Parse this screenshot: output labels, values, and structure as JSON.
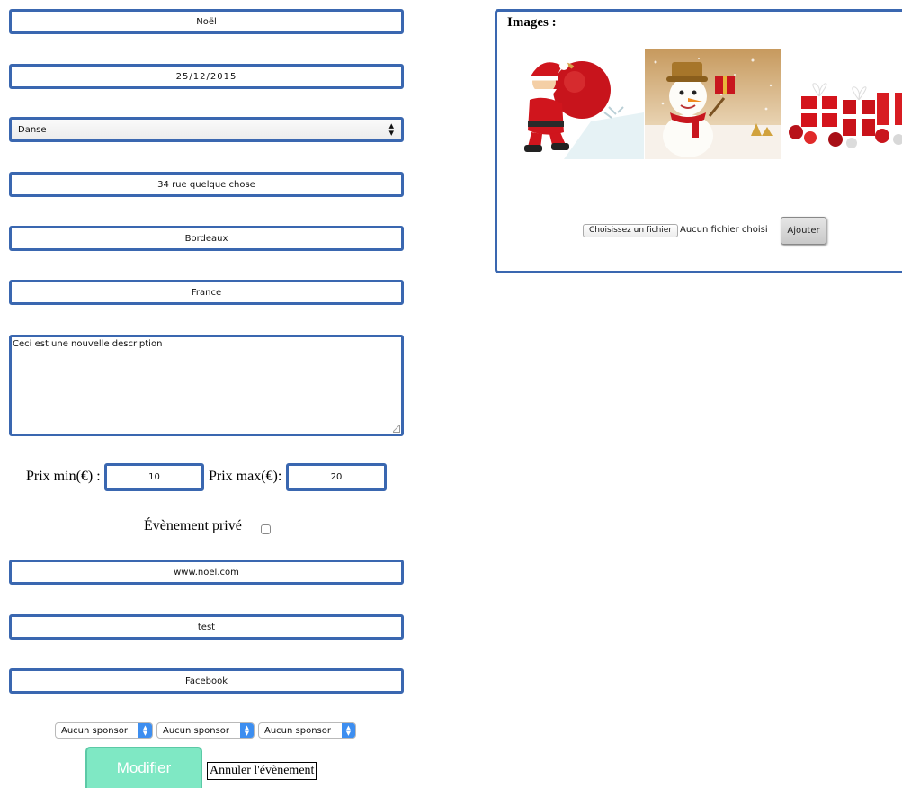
{
  "form": {
    "name": "Noël",
    "date": "25/12/2015",
    "category": "Danse",
    "address": "34 rue quelque chose",
    "city": "Bordeaux",
    "country": "France",
    "description": "Ceci est une nouvelle description",
    "price_min_label": "Prix min(€) :",
    "price_min": "10",
    "price_max_label": "Prix max(€):",
    "price_max": "20",
    "private_label": "Évènement privé",
    "private_checked": false,
    "website": "www.noel.com",
    "extra": "test",
    "social": "Facebook",
    "sponsors": [
      "Aucun sponsor",
      "Aucun sponsor",
      "Aucun sponsor"
    ],
    "submit_label": "Modifier",
    "cancel_label": "Annuler l'évènement"
  },
  "images_panel": {
    "title": "Images :",
    "choose_file_label": "Choisissez un fichier",
    "file_status": "Aucun fichier choisi",
    "add_label": "Ajouter",
    "thumbnails": [
      "santa-claus-image",
      "snowman-image",
      "gift-boxes-image"
    ]
  },
  "colors": {
    "field_border": "#3a67b0",
    "submit_bg": "#7fe8c4",
    "stepper_blue": "#3d8ef0"
  }
}
